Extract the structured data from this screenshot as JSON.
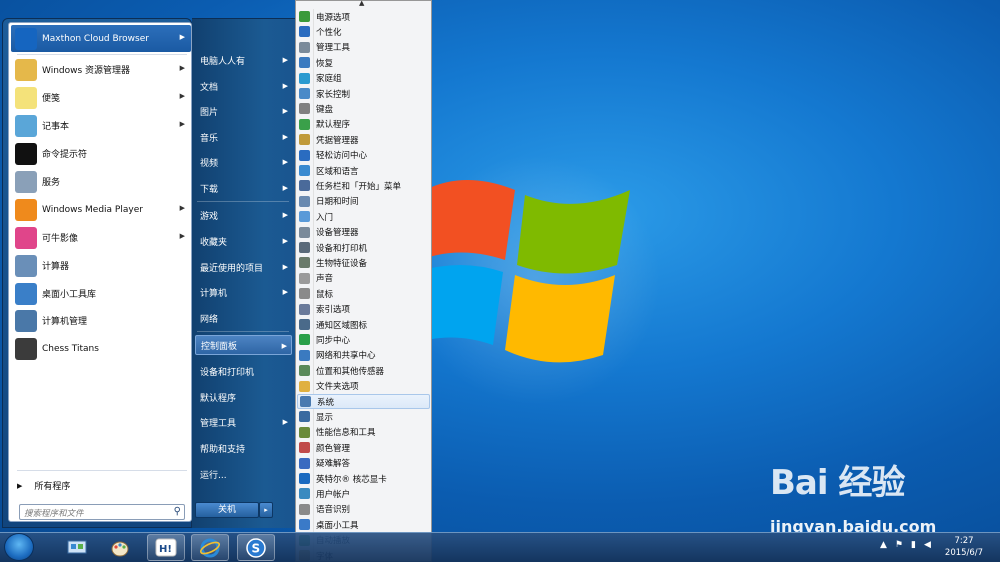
{
  "desktop": {
    "watermark_brand": "Bai 经验",
    "watermark_url": "jingyan.baidu.com"
  },
  "programs": [
    {
      "label": "Maxthon Cloud Browser",
      "icon": "maxthon-icon",
      "color": "#1565c0",
      "arrow": true
    },
    {
      "label": "Windows 资源管理器",
      "icon": "explorer-icon",
      "color": "#e5b84a",
      "arrow": true
    },
    {
      "label": "便笺",
      "icon": "sticky-notes-icon",
      "color": "#f4e27a",
      "arrow": true
    },
    {
      "label": "记事本",
      "icon": "notepad-icon",
      "color": "#5aa6d8",
      "arrow": true
    },
    {
      "label": "命令提示符",
      "icon": "cmd-icon",
      "color": "#111111",
      "arrow": false
    },
    {
      "label": "服务",
      "icon": "services-icon",
      "color": "#8aa0b8",
      "arrow": false
    },
    {
      "label": "Windows Media Player",
      "icon": "media-player-icon",
      "color": "#ef8a1c",
      "arrow": true
    },
    {
      "label": "可牛影像",
      "icon": "keniu-icon",
      "color": "#e0458a",
      "arrow": true
    },
    {
      "label": "计算器",
      "icon": "calculator-icon",
      "color": "#6a8fb8",
      "arrow": false
    },
    {
      "label": "桌面小工具库",
      "icon": "gadgets-icon",
      "color": "#3a7fc8",
      "arrow": false
    },
    {
      "label": "计算机管理",
      "icon": "computer-management-icon",
      "color": "#4a78a8",
      "arrow": false
    },
    {
      "label": "Chess Titans",
      "icon": "chess-icon",
      "color": "#3b3b3b",
      "arrow": false
    }
  ],
  "all_programs_label": "所有程序",
  "search_placeholder": "搜索程序和文件",
  "right_menu": [
    {
      "label": "电脑人人有",
      "arrow": true
    },
    {
      "label": "文档",
      "arrow": true
    },
    {
      "label": "图片",
      "arrow": true
    },
    {
      "label": "音乐",
      "arrow": true
    },
    {
      "label": "视频",
      "arrow": true
    },
    {
      "label": "下载",
      "arrow": true
    },
    {
      "label": "游戏",
      "arrow": true
    },
    {
      "label": "收藏夹",
      "arrow": true
    },
    {
      "label": "最近使用的项目",
      "arrow": true
    },
    {
      "label": "计算机",
      "arrow": true
    },
    {
      "label": "网络",
      "arrow": false
    },
    {
      "label": "控制面板",
      "arrow": true
    },
    {
      "label": "设备和打印机",
      "arrow": false
    },
    {
      "label": "默认程序",
      "arrow": false
    },
    {
      "label": "管理工具",
      "arrow": true
    },
    {
      "label": "帮助和支持",
      "arrow": false
    },
    {
      "label": "运行...",
      "arrow": false
    }
  ],
  "shutdown_label": "关机",
  "control_panel_items": [
    {
      "label": "电源选项",
      "color": "#3a9a3a"
    },
    {
      "label": "个性化",
      "color": "#2a6cc0"
    },
    {
      "label": "管理工具",
      "color": "#7a8a9a"
    },
    {
      "label": "恢复",
      "color": "#3a7ac0"
    },
    {
      "label": "家庭组",
      "color": "#2a9ad0"
    },
    {
      "label": "家长控制",
      "color": "#4a8ac8"
    },
    {
      "label": "键盘",
      "color": "#808080"
    },
    {
      "label": "默认程序",
      "color": "#3aa04a"
    },
    {
      "label": "凭据管理器",
      "color": "#c09a3a"
    },
    {
      "label": "轻松访问中心",
      "color": "#2a6cc0"
    },
    {
      "label": "区域和语言",
      "color": "#3a8ad0"
    },
    {
      "label": "任务栏和「开始」菜单",
      "color": "#4a6a9a"
    },
    {
      "label": "日期和时间",
      "color": "#6a8ab0"
    },
    {
      "label": "入门",
      "color": "#5a9ad8"
    },
    {
      "label": "设备管理器",
      "color": "#7a8a9a"
    },
    {
      "label": "设备和打印机",
      "color": "#5a6a7a"
    },
    {
      "label": "生物特征设备",
      "color": "#6a7a6a"
    },
    {
      "label": "声音",
      "color": "#9a9a9a"
    },
    {
      "label": "鼠标",
      "color": "#8a8a8a"
    },
    {
      "label": "索引选项",
      "color": "#6a7a9a"
    },
    {
      "label": "通知区域图标",
      "color": "#4a6a8a"
    },
    {
      "label": "同步中心",
      "color": "#2aa04a"
    },
    {
      "label": "网络和共享中心",
      "color": "#3a7ac0"
    },
    {
      "label": "位置和其他传感器",
      "color": "#5a8a5a"
    },
    {
      "label": "文件夹选项",
      "color": "#e0b040"
    },
    {
      "label": "系统",
      "color": "#4a7ab0"
    },
    {
      "label": "显示",
      "color": "#3a6aa0"
    },
    {
      "label": "性能信息和工具",
      "color": "#6a8a3a"
    },
    {
      "label": "颜色管理",
      "color": "#c04a4a"
    },
    {
      "label": "疑难解答",
      "color": "#3a6ac0"
    },
    {
      "label": "英特尔® 核芯显卡",
      "color": "#1a6ac0"
    },
    {
      "label": "用户帐户",
      "color": "#3a8ac0"
    },
    {
      "label": "语音识别",
      "color": "#8a8a8a"
    },
    {
      "label": "桌面小工具",
      "color": "#3a7ac8"
    },
    {
      "label": "自动播放",
      "color": "#3aa04a"
    },
    {
      "label": "字体",
      "color": "#c8a040"
    }
  ],
  "taskbar": {
    "time": "7:27",
    "date": "2015/6/7"
  }
}
